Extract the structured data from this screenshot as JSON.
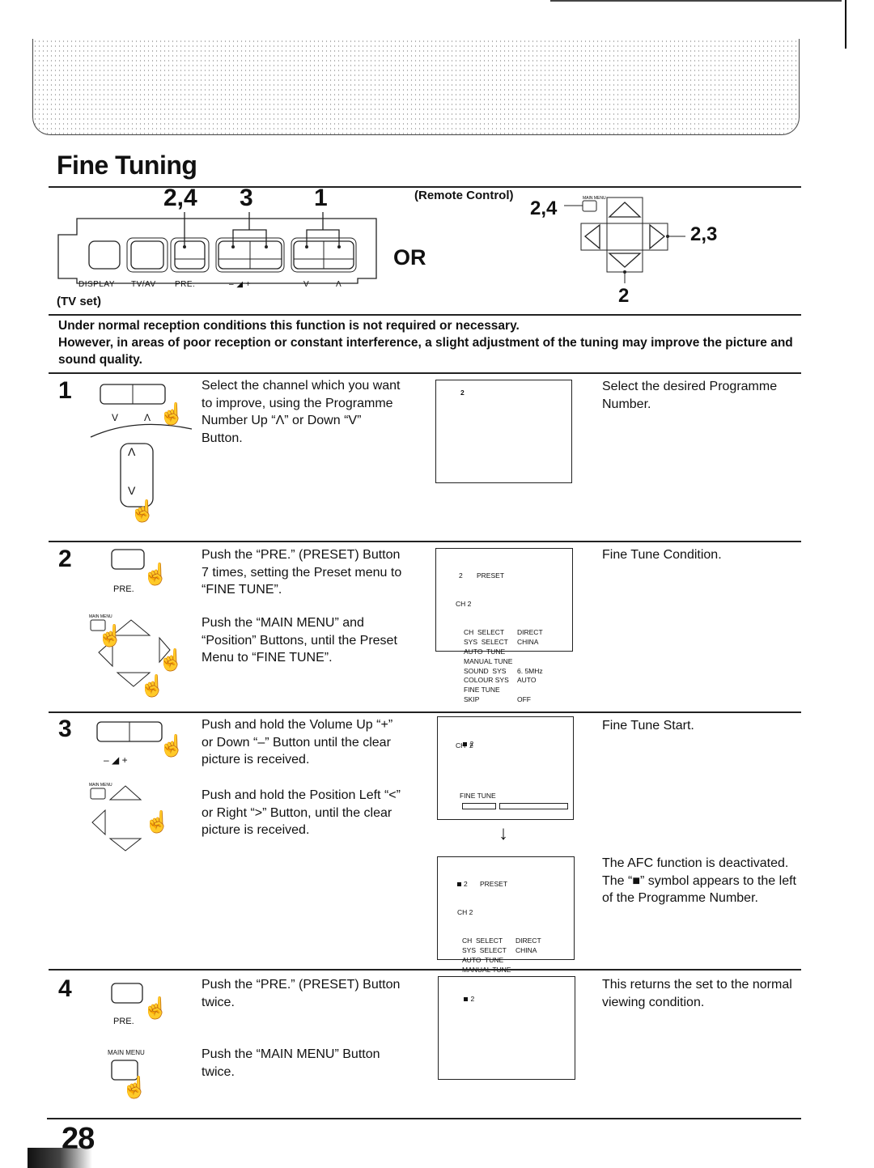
{
  "page": {
    "title": "Fine Tuning",
    "page_number": "28"
  },
  "tv_panel": {
    "labels": [
      "DISPLAY",
      "TV/AV",
      "PRE.",
      "– ◢ +",
      "V",
      "Λ"
    ],
    "callouts": {
      "pre": "2,4",
      "volume": "3",
      "programme": "1"
    },
    "caption": "(TV set)"
  },
  "or_label": "OR",
  "remote": {
    "caption": "(Remote Control)",
    "main_menu_label": "MAIN MENU",
    "callout_main_menu": "2,4",
    "callout_right": "2,3",
    "callout_down": "2"
  },
  "intro": {
    "line1": "Under normal reception conditions this function is not required or necessary.",
    "line2": "However, in areas of poor reception or constant interference, a slight adjustment of the tuning may improve the picture and sound quality."
  },
  "steps": [
    {
      "number": "1",
      "instructions": [
        "Select the channel which you want to improve, using the Programme Number Up “Λ” or Down “V” Button."
      ],
      "icon_labels": [
        "V",
        "Λ"
      ],
      "result": "Select the desired Programme Number."
    },
    {
      "number": "2",
      "instructions": [
        "Push the “PRE.” (PRESET) Button 7 times, setting the Preset menu to “FINE TUNE”.",
        "Push the “MAIN MENU” and “Position” Buttons, until the Preset Menu to “FINE TUNE”."
      ],
      "icon_labels": [
        "PRE.",
        "MAIN MENU"
      ],
      "result": "Fine Tune Condition."
    },
    {
      "number": "3",
      "instructions": [
        "Push and hold the Volume Up “+” or Down “–” Button until the clear picture is received.",
        "Push and hold the Position Left “<” or Right “>” Button, until the clear picture is received."
      ],
      "icon_labels": [
        "– ◢ +",
        "MAIN MENU"
      ],
      "result": "Fine Tune Start.",
      "result2": "The AFC function is deactivated.",
      "result3": "The “■” symbol appears to the left of the Programme Number."
    },
    {
      "number": "4",
      "instructions": [
        "Push the “PRE.” (PRESET) Button twice.",
        "Push the “MAIN MENU” Button twice."
      ],
      "icon_labels": [
        "PRE.",
        "MAIN MENU"
      ],
      "result": "This returns the set to the normal viewing condition."
    }
  ],
  "screens": {
    "s1": {
      "prog": "2"
    },
    "preset_menu": {
      "title_num": "2",
      "title": "PRESET",
      "ch": "CH 2",
      "rows": [
        {
          "k": "CH  SELECT",
          "v": "DIRECT"
        },
        {
          "k": "SYS  SELECT",
          "v": "CHINA"
        },
        {
          "k": "AUTO  TUNE",
          "v": ""
        },
        {
          "k": "MANUAL TUNE",
          "v": ""
        },
        {
          "k": "SOUND  SYS",
          "v": "6. 5MHz"
        },
        {
          "k": "COLOUR SYS",
          "v": "AUTO"
        },
        {
          "k": "FINE TUNE",
          "v": ""
        },
        {
          "k": "SKIP",
          "v": "OFF"
        }
      ]
    },
    "fine_tune": {
      "prog": "2",
      "ch": "CH  2",
      "label": "FINE TUNE",
      "afc_symbol": "■"
    },
    "preset_menu_afc": {
      "title_num": "2",
      "title": "PRESET",
      "ch": "CH 2",
      "afc_symbol": "■"
    },
    "final": {
      "prog": "2",
      "afc_symbol": "■"
    },
    "arrow": "↓"
  }
}
